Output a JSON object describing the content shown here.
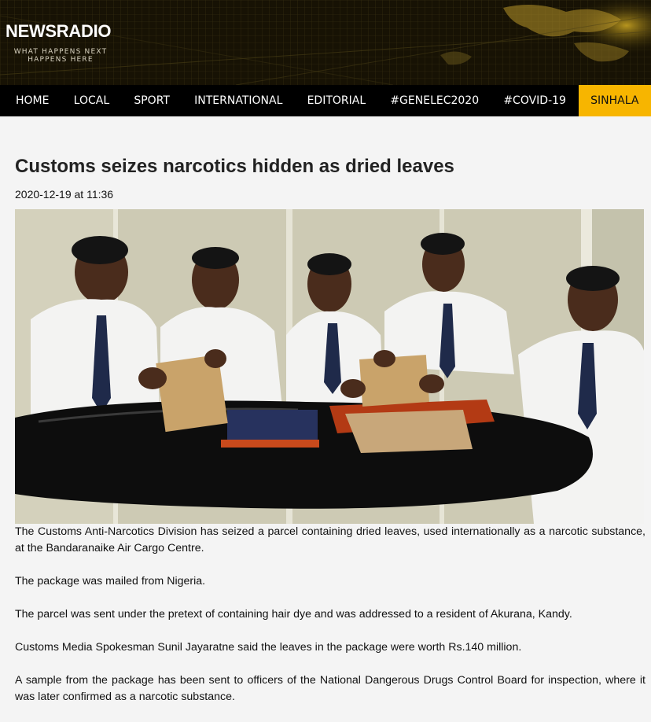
{
  "site": {
    "logo": "NEWSRADIO",
    "tagline": "WHAT HAPPENS NEXT HAPPENS HERE"
  },
  "nav": {
    "items": [
      "HOME",
      "LOCAL",
      "SPORT",
      "INTERNATIONAL",
      "EDITORIAL",
      "#GENELEC2020",
      "#COVID-19"
    ],
    "highlight": "SINHALA"
  },
  "article": {
    "title": "Customs seizes narcotics hidden as dried leaves",
    "date": "2020-12-19 at 11:36",
    "paragraphs": [
      "The Customs Anti-Narcotics Division has seized a parcel containing dried leaves, used internationally as a narcotic substance, at the Bandaranaike Air Cargo Centre.",
      "The package was mailed  from Nigeria.",
      "The parcel was sent under the pretext of containing hair dye and was addressed to a resident of Akurana, Kandy.",
      "Customs Media Spokesman Sunil Jayaratne said the leaves in the package were worth Rs.140 million.",
      "A sample from the package has been sent to officers of the National Dangerous Drugs Control Board for inspection, where it was later confirmed as a narcotic substance."
    ]
  },
  "colors": {
    "nav_background": "#000000",
    "highlight": "#f7b500",
    "banner": "#171204",
    "page_background": "#f4f4f4"
  }
}
